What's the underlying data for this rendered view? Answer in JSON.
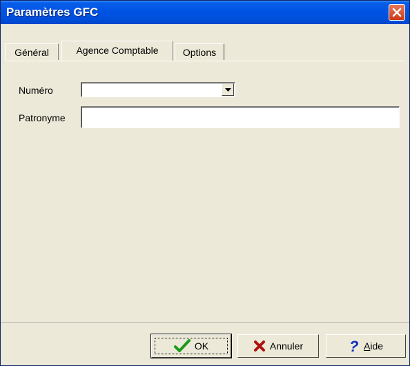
{
  "window": {
    "title": "Paramètres GFC"
  },
  "tabs": [
    {
      "label": "Général",
      "active": false
    },
    {
      "label": "Agence Comptable",
      "active": true
    },
    {
      "label": "Options",
      "active": false
    }
  ],
  "form": {
    "numero": {
      "label": "Numéro",
      "value": ""
    },
    "patronyme": {
      "label": "Patronyme",
      "value": ""
    }
  },
  "buttons": {
    "ok": {
      "label": "OK",
      "icon": "checkmark-icon"
    },
    "cancel": {
      "label": "Annuler",
      "icon": "x-icon"
    },
    "help": {
      "label_prefix": "A",
      "label_rest": "ide",
      "icon": "question-icon"
    }
  },
  "colors": {
    "title_bar": "#0055e5",
    "close_button": "#cc3b16",
    "ok_icon": "#1a9a1a",
    "cancel_icon": "#b01010",
    "help_icon": "#1030c0"
  }
}
